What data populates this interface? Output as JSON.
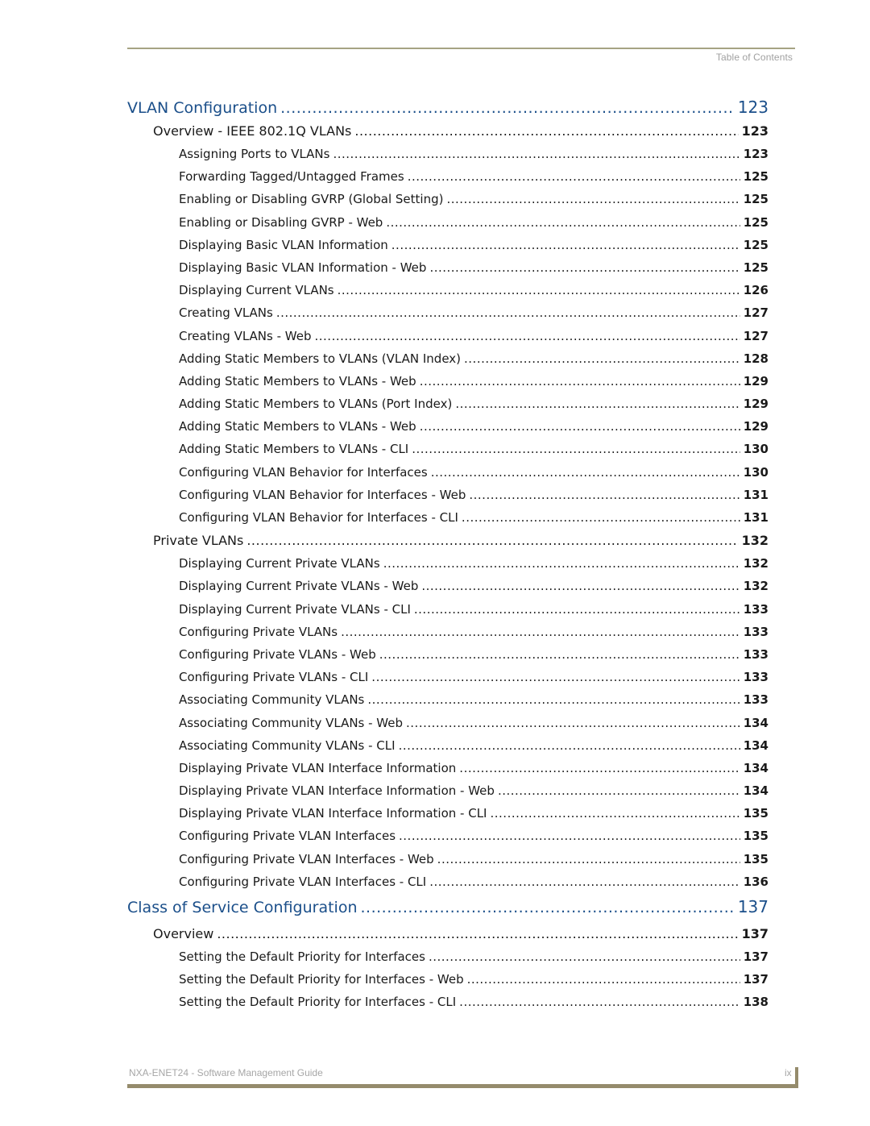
{
  "header": {
    "running_head": "Table of Contents"
  },
  "footer": {
    "title": "NXA-ENET24 - Software Management Guide",
    "page": "ix"
  },
  "colors": {
    "chapter_heading": "#1b4f8a",
    "rule": "#a6a383",
    "footer_bar": "#958b6c"
  },
  "toc": [
    {
      "level": 1,
      "title": "VLAN Configuration",
      "page": "123"
    },
    {
      "level": 2,
      "title": "Overview - IEEE 802.1Q VLANs",
      "page": "123"
    },
    {
      "level": 3,
      "title": "Assigning Ports to VLANs",
      "page": "123"
    },
    {
      "level": 3,
      "title": "Forwarding Tagged/Untagged Frames",
      "page": "125"
    },
    {
      "level": 3,
      "title": "Enabling or Disabling GVRP (Global Setting)",
      "page": "125"
    },
    {
      "level": 3,
      "title": "Enabling or Disabling GVRP - Web",
      "page": "125"
    },
    {
      "level": 3,
      "title": "Displaying Basic VLAN Information",
      "page": "125"
    },
    {
      "level": 3,
      "title": "Displaying Basic VLAN Information - Web",
      "page": "125"
    },
    {
      "level": 3,
      "title": "Displaying Current VLANs",
      "page": "126"
    },
    {
      "level": 3,
      "title": "Creating VLANs",
      "page": "127"
    },
    {
      "level": 3,
      "title": "Creating VLANs - Web",
      "page": "127"
    },
    {
      "level": 3,
      "title": "Adding Static Members to VLANs (VLAN Index)",
      "page": "128"
    },
    {
      "level": 3,
      "title": "Adding Static Members to VLANs - Web",
      "page": "129"
    },
    {
      "level": 3,
      "title": "Adding Static Members to VLANs (Port Index)",
      "page": "129"
    },
    {
      "level": 3,
      "title": "Adding Static Members to VLANs - Web",
      "page": "129"
    },
    {
      "level": 3,
      "title": "Adding Static Members to VLANs - CLI",
      "page": "130"
    },
    {
      "level": 3,
      "title": "Configuring VLAN Behavior for Interfaces",
      "page": "130"
    },
    {
      "level": 3,
      "title": "Configuring VLAN Behavior for Interfaces - Web",
      "page": "131"
    },
    {
      "level": 3,
      "title": "Configuring VLAN Behavior for Interfaces - CLI",
      "page": "131"
    },
    {
      "level": 2,
      "title": "Private VLANs",
      "page": "132"
    },
    {
      "level": 3,
      "title": "Displaying Current Private VLANs",
      "page": "132"
    },
    {
      "level": 3,
      "title": "Displaying Current Private VLANs - Web",
      "page": "132"
    },
    {
      "level": 3,
      "title": "Displaying Current Private VLANs - CLI",
      "page": "133"
    },
    {
      "level": 3,
      "title": "Configuring Private VLANs",
      "page": "133"
    },
    {
      "level": 3,
      "title": "Configuring Private VLANs - Web",
      "page": "133"
    },
    {
      "level": 3,
      "title": "Configuring Private VLANs - CLI",
      "page": "133"
    },
    {
      "level": 3,
      "title": "Associating Community VLANs",
      "page": "133"
    },
    {
      "level": 3,
      "title": "Associating Community VLANs - Web",
      "page": "134"
    },
    {
      "level": 3,
      "title": "Associating Community VLANs - CLI",
      "page": "134"
    },
    {
      "level": 3,
      "title": "Displaying Private VLAN Interface Information",
      "page": "134"
    },
    {
      "level": 3,
      "title": "Displaying Private VLAN Interface Information - Web",
      "page": "134"
    },
    {
      "level": 3,
      "title": "Displaying Private VLAN Interface Information - CLI",
      "page": "135"
    },
    {
      "level": 3,
      "title": "Configuring Private VLAN Interfaces",
      "page": "135"
    },
    {
      "level": 3,
      "title": "Configuring Private VLAN Interfaces - Web",
      "page": "135"
    },
    {
      "level": 3,
      "title": "Configuring Private VLAN Interfaces - CLI",
      "page": "136"
    },
    {
      "level": 1,
      "title": "Class of Service Configuration",
      "page": "137"
    },
    {
      "level": 2,
      "title": "Overview",
      "page": "137"
    },
    {
      "level": 3,
      "title": "Setting the Default Priority for Interfaces",
      "page": "137"
    },
    {
      "level": 3,
      "title": "Setting the Default Priority for Interfaces - Web",
      "page": "137"
    },
    {
      "level": 3,
      "title": "Setting the Default Priority for Interfaces - CLI",
      "page": "138"
    }
  ]
}
